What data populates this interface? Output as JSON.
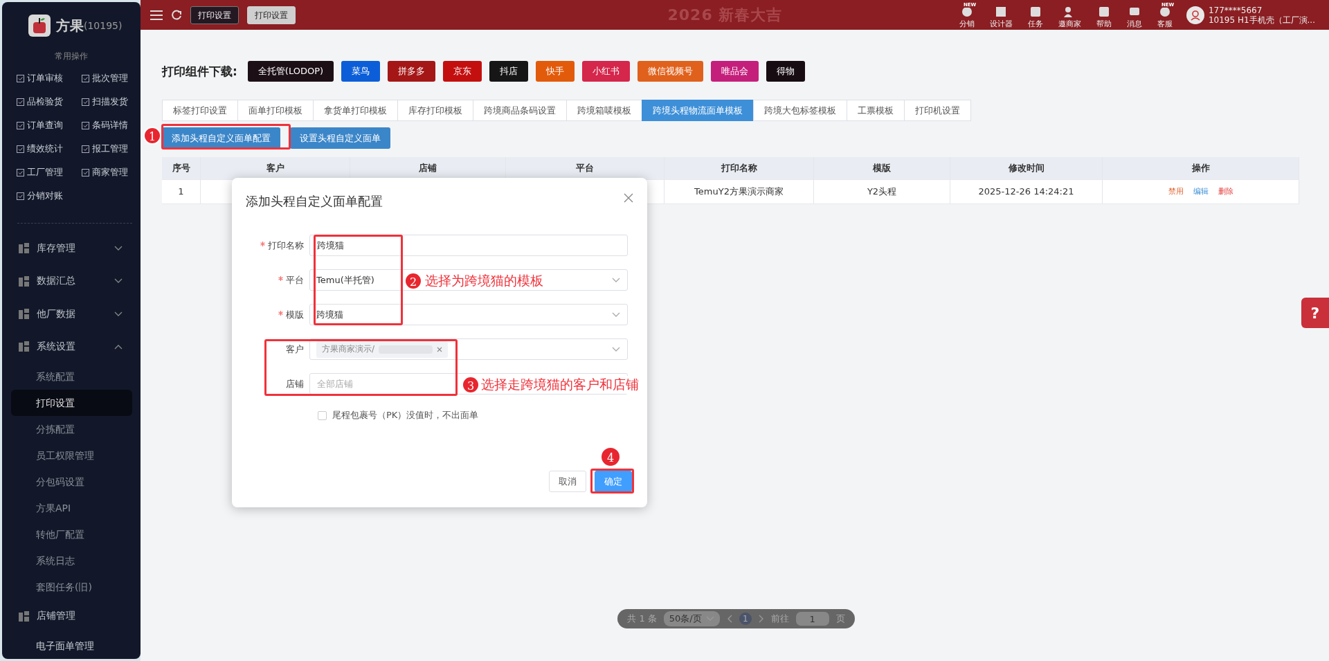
{
  "sidebar": {
    "brand": "方果",
    "account": "(10195)",
    "section_title": "常用操作",
    "shortcuts": [
      {
        "label": "订单审核"
      },
      {
        "label": "批次管理"
      },
      {
        "label": "品检验货"
      },
      {
        "label": "扫描发货"
      },
      {
        "label": "订单查询"
      },
      {
        "label": "条码详情"
      },
      {
        "label": "绩效统计"
      },
      {
        "label": "报工管理"
      },
      {
        "label": "工厂管理"
      },
      {
        "label": "商家管理"
      },
      {
        "label": "分销对账"
      }
    ],
    "menus": [
      {
        "label": "库存管理",
        "kind": "collapsible",
        "expanded": false
      },
      {
        "label": "数据汇总",
        "kind": "collapsible",
        "expanded": false
      },
      {
        "label": "他厂数据",
        "kind": "collapsible",
        "expanded": false
      },
      {
        "label": "系统设置",
        "kind": "collapsible",
        "expanded": true,
        "children": [
          {
            "label": "系统配置",
            "selected": false
          },
          {
            "label": "打印设置",
            "selected": true
          },
          {
            "label": "分拣配置",
            "selected": false
          },
          {
            "label": "员工权限管理",
            "selected": false
          },
          {
            "label": "分包码设置",
            "selected": false
          },
          {
            "label": "方果API",
            "selected": false
          },
          {
            "label": "转他厂配置",
            "selected": false
          },
          {
            "label": "系统日志",
            "selected": false
          },
          {
            "label": "套图任务(旧)",
            "selected": false
          }
        ]
      },
      {
        "label": "店铺管理",
        "kind": "plain",
        "expanded": true,
        "children": [
          {
            "label": "电子面单管理",
            "selected": false
          }
        ]
      }
    ]
  },
  "header": {
    "tabs": [
      {
        "label": "打印设置",
        "selected": false
      },
      {
        "label": "打印设置",
        "selected": true
      }
    ],
    "banner": "2026 新春大吉",
    "tools": [
      {
        "label": "分销",
        "badge": "NEW"
      },
      {
        "label": "设计器"
      },
      {
        "label": "任务"
      },
      {
        "label": "邀商家"
      },
      {
        "label": "帮助"
      },
      {
        "label": "消息"
      },
      {
        "label": "客服",
        "badge": "NEW"
      }
    ],
    "user": {
      "phone": "177****5667",
      "account": "10195  H1手机壳（工厂演..."
    }
  },
  "main": {
    "download_label": "打印组件下载:",
    "vendors": [
      {
        "label": "全托管(LODOP)",
        "color": "#1c0f16"
      },
      {
        "label": "菜鸟",
        "color": "#0c5ed8"
      },
      {
        "label": "拼多多",
        "color": "#a51616"
      },
      {
        "label": "京东",
        "color": "#c40f0f"
      },
      {
        "label": "抖店",
        "color": "#161616"
      },
      {
        "label": "快手",
        "color": "#e25b0b"
      },
      {
        "label": "小红书",
        "color": "#d5264c"
      },
      {
        "label": "微信视频号",
        "color": "#e0611c"
      },
      {
        "label": "唯品会",
        "color": "#c51f7c"
      },
      {
        "label": "得物",
        "color": "#170c12"
      }
    ],
    "tabs": [
      {
        "label": "标签打印设置",
        "selected": false
      },
      {
        "label": "面单打印模板",
        "selected": false
      },
      {
        "label": "拿货单打印模板",
        "selected": false
      },
      {
        "label": "库存打印模板",
        "selected": false
      },
      {
        "label": "跨境商品条码设置",
        "selected": false
      },
      {
        "label": "跨境箱唛模板",
        "selected": false
      },
      {
        "label": "跨境头程物流面单模板",
        "selected": true
      },
      {
        "label": "跨境大包标签模板",
        "selected": false
      },
      {
        "label": "工票模板",
        "selected": false
      },
      {
        "label": "打印机设置",
        "selected": false
      }
    ],
    "actions": [
      "添加头程自定义面单配置",
      "设置头程自定义面单"
    ],
    "table": {
      "columns": [
        "序号",
        "客户",
        "店铺",
        "平台",
        "打印名称",
        "模版",
        "修改时间",
        "操作"
      ],
      "rows": [
        {
          "index": "1",
          "print_name": "TemuY2方果演示商家",
          "template": "Y2头程",
          "modified": "2025-12-26 14:24:21",
          "actions": [
            {
              "label": "禁用",
              "kind": "disable"
            },
            {
              "label": "编辑",
              "kind": "edit"
            },
            {
              "label": "删除",
              "kind": "delete"
            }
          ]
        }
      ]
    },
    "pagination": {
      "total": "共 1 条",
      "page_size": "50条/页",
      "pages": [
        {
          "label": "1",
          "selected": true
        }
      ],
      "goto_label": "前往",
      "goto_value": "1",
      "page_unit": "页"
    }
  },
  "dialog": {
    "title": "添加头程自定义面单配置",
    "fields": [
      {
        "label": "打印名称",
        "required": true,
        "kind": "input",
        "value": "跨境猫"
      },
      {
        "label": "平台",
        "required": true,
        "kind": "select",
        "value": "Temu(半托管)"
      },
      {
        "label": "模版",
        "required": true,
        "kind": "select",
        "value": "跨境猫"
      },
      {
        "label": "客户",
        "required": false,
        "kind": "tags",
        "tags": [
          "方果商家演示/"
        ]
      },
      {
        "label": "店铺",
        "required": false,
        "kind": "input",
        "placeholder": "全部店铺"
      }
    ],
    "checkbox": {
      "label": "尾程包裹号（PK）没值时，不出面单",
      "checked": false
    },
    "buttons": [
      {
        "label": "取消",
        "kind": "secondary"
      },
      {
        "label": "确定",
        "kind": "primary"
      }
    ]
  },
  "annotations": [
    {
      "number": "1"
    },
    {
      "number": "2",
      "note": "选择为跨境猫的模板"
    },
    {
      "number": "3",
      "note": "选择走跨境猫的客户和店铺"
    },
    {
      "number": "4"
    }
  ],
  "help_button": "?"
}
